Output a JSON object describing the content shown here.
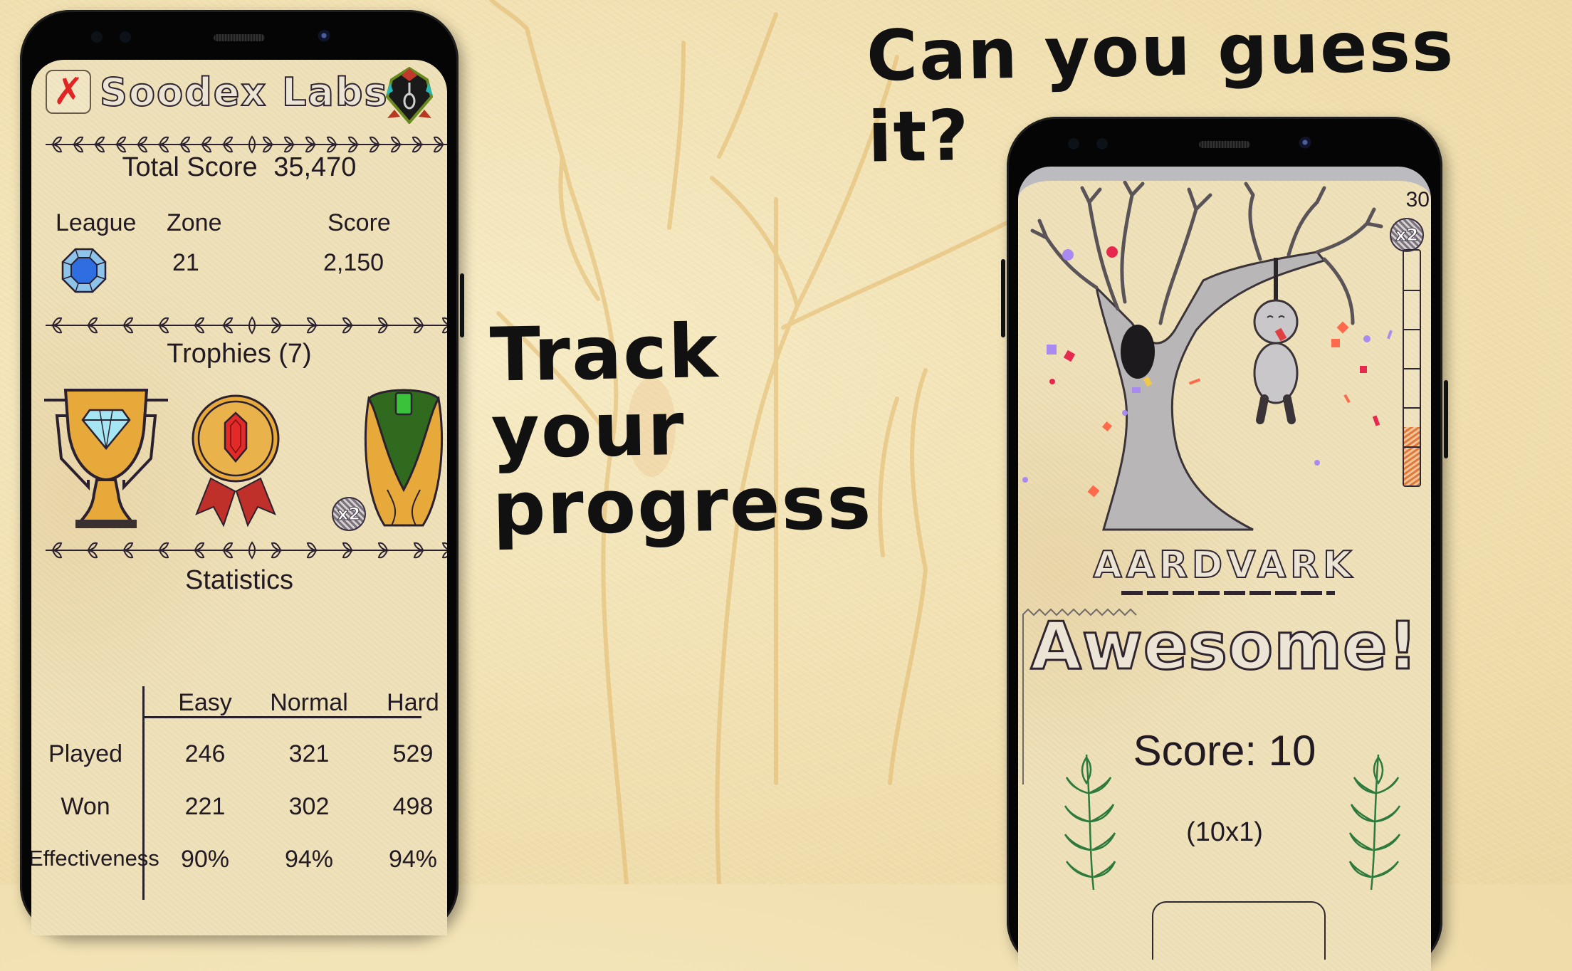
{
  "promo": {
    "headline_top": "Can you guess it?",
    "headline_mid_lines": [
      "Track",
      "your",
      "progress"
    ]
  },
  "profile_screen": {
    "header": {
      "close_icon": "close-x-icon",
      "title": "Soodex Labs",
      "emblem_icon": "hangman-shield-emblem-icon"
    },
    "total_score_label": "Total Score",
    "total_score_value": "35,470",
    "summary": {
      "league_label": "League",
      "league_icon": "sapphire-gem-icon",
      "zone_label": "Zone",
      "zone_value": "21",
      "score_label": "Score",
      "score_value": "2,150"
    },
    "trophies": {
      "title": "Trophies (7)",
      "items": [
        {
          "name": "diamond-cup-trophy-icon",
          "multiplier": ""
        },
        {
          "name": "ruby-medal-trophy-icon",
          "multiplier": ""
        },
        {
          "name": "emerald-cup-trophy-icon",
          "multiplier": "x2"
        }
      ]
    },
    "statistics": {
      "title": "Statistics",
      "columns": [
        "Easy",
        "Normal",
        "Hard"
      ],
      "rows": [
        {
          "label": "Played",
          "values": [
            "246",
            "321",
            "529"
          ]
        },
        {
          "label": "Won",
          "values": [
            "221",
            "302",
            "498"
          ]
        },
        {
          "label": "Effectiveness",
          "values": [
            "90%",
            "94%",
            "94%"
          ]
        }
      ]
    }
  },
  "game_screen": {
    "timer": "30",
    "multiplier_badge": "x2",
    "progress": {
      "segments": 6,
      "filled_fraction": 0.25
    },
    "scene": "hangman-tree-confetti-illustration",
    "word": "AARDVARK",
    "result_title": "Awesome!",
    "score_text": "Score: 10",
    "score_formula": "(10x1)"
  },
  "colors": {
    "background": "#f2e2b4",
    "ink": "#221a22",
    "accent_red": "#e02525",
    "laurel_green": "#2e7a3c",
    "trophy_gold": "#e6a93a"
  }
}
